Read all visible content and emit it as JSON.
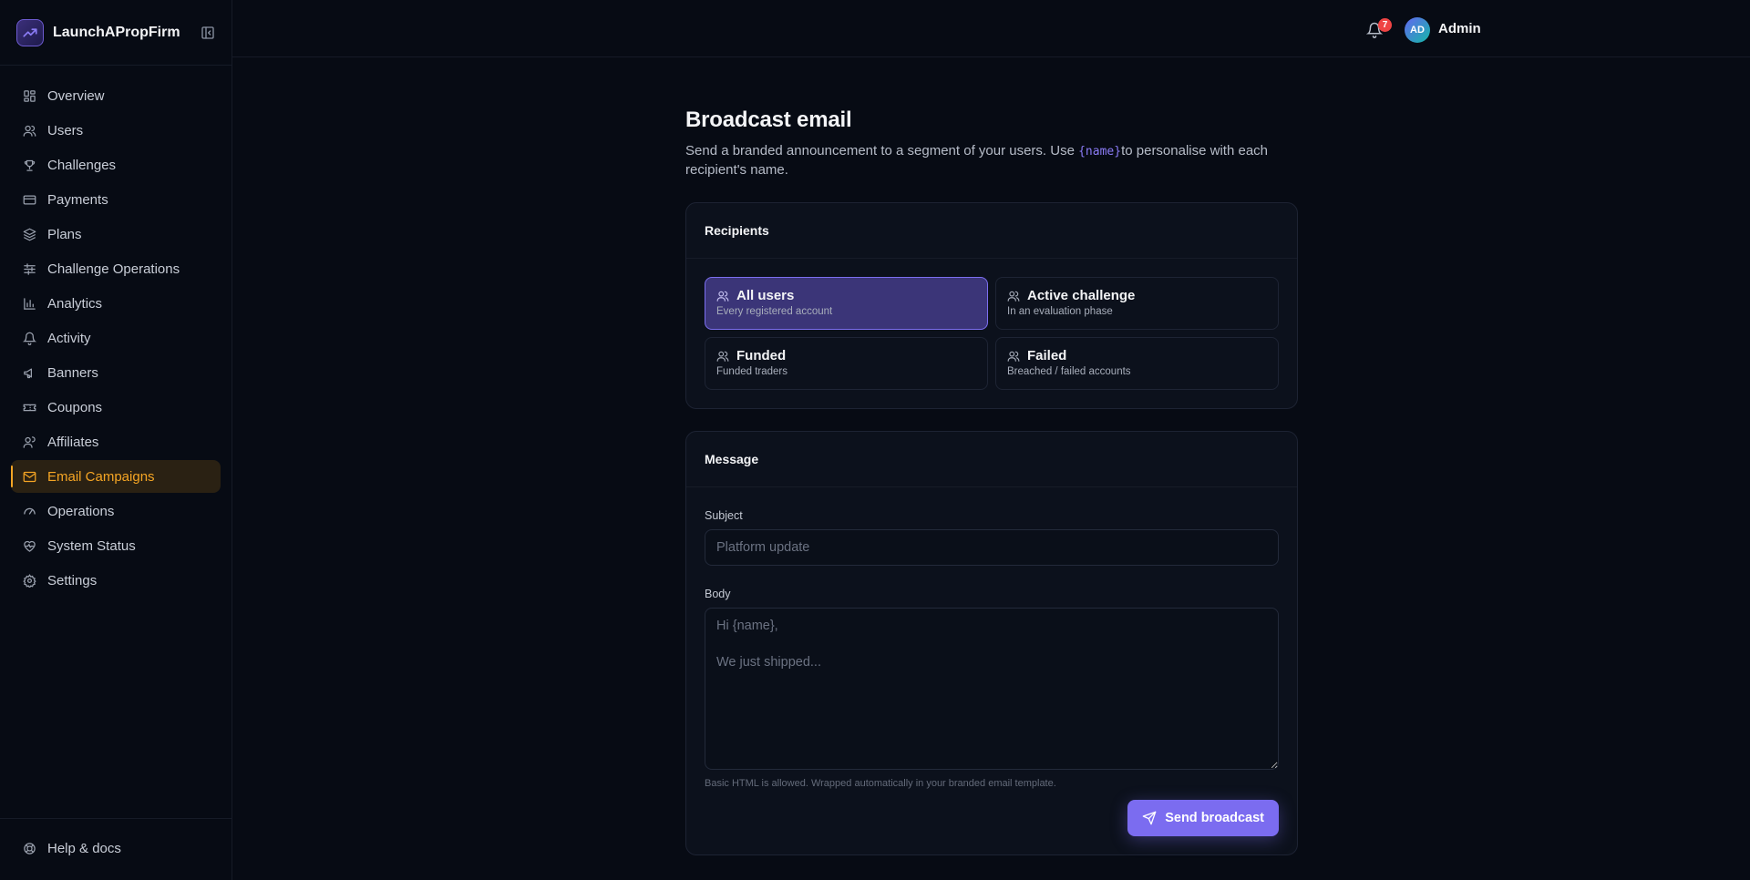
{
  "brand": {
    "name": "LaunchAPropFirm"
  },
  "sidebar": {
    "items": [
      {
        "label": "Overview",
        "icon": "grid-icon"
      },
      {
        "label": "Users",
        "icon": "users-icon"
      },
      {
        "label": "Challenges",
        "icon": "trophy-icon"
      },
      {
        "label": "Payments",
        "icon": "credit-card-icon"
      },
      {
        "label": "Plans",
        "icon": "layers-icon"
      },
      {
        "label": "Challenge Operations",
        "icon": "sliders-icon"
      },
      {
        "label": "Analytics",
        "icon": "bar-chart-icon"
      },
      {
        "label": "Activity",
        "icon": "bell-icon"
      },
      {
        "label": "Banners",
        "icon": "megaphone-icon"
      },
      {
        "label": "Coupons",
        "icon": "ticket-icon"
      },
      {
        "label": "Affiliates",
        "icon": "user-plus-icon"
      },
      {
        "label": "Email Campaigns",
        "icon": "mail-icon",
        "active": true
      },
      {
        "label": "Operations",
        "icon": "gauge-icon"
      },
      {
        "label": "System Status",
        "icon": "heart-pulse-icon"
      },
      {
        "label": "Settings",
        "icon": "gear-icon"
      }
    ],
    "footer": {
      "label": "Help & docs",
      "icon": "lifebuoy-icon"
    }
  },
  "topbar": {
    "notification_count": "7",
    "avatar_initials": "AD",
    "user_name": "Admin"
  },
  "page": {
    "title": "Broadcast email",
    "desc_before": "Send a branded announcement to a segment of your users. Use ",
    "desc_code": "{name}",
    "desc_after": "to personalise with each recipient's name."
  },
  "recipients": {
    "title": "Recipients",
    "segments": [
      {
        "label": "All users",
        "sub": "Every registered account",
        "selected": true
      },
      {
        "label": "Active challenge",
        "sub": "In an evaluation phase",
        "selected": false
      },
      {
        "label": "Funded",
        "sub": "Funded traders",
        "selected": false
      },
      {
        "label": "Failed",
        "sub": "Breached / failed accounts",
        "selected": false
      }
    ]
  },
  "message": {
    "title": "Message",
    "subject_label": "Subject",
    "subject_placeholder": "Platform update",
    "subject_value": "",
    "body_label": "Body",
    "body_placeholder": "Hi {name},\n\nWe just shipped...",
    "body_value": "",
    "hint": "Basic HTML is allowed. Wrapped automatically in your branded email template.",
    "send_label": "Send broadcast"
  },
  "colors": {
    "accent": "#7b6cf0",
    "active_nav": "#f5a524",
    "badge": "#ef4444",
    "background": "#070b14"
  }
}
